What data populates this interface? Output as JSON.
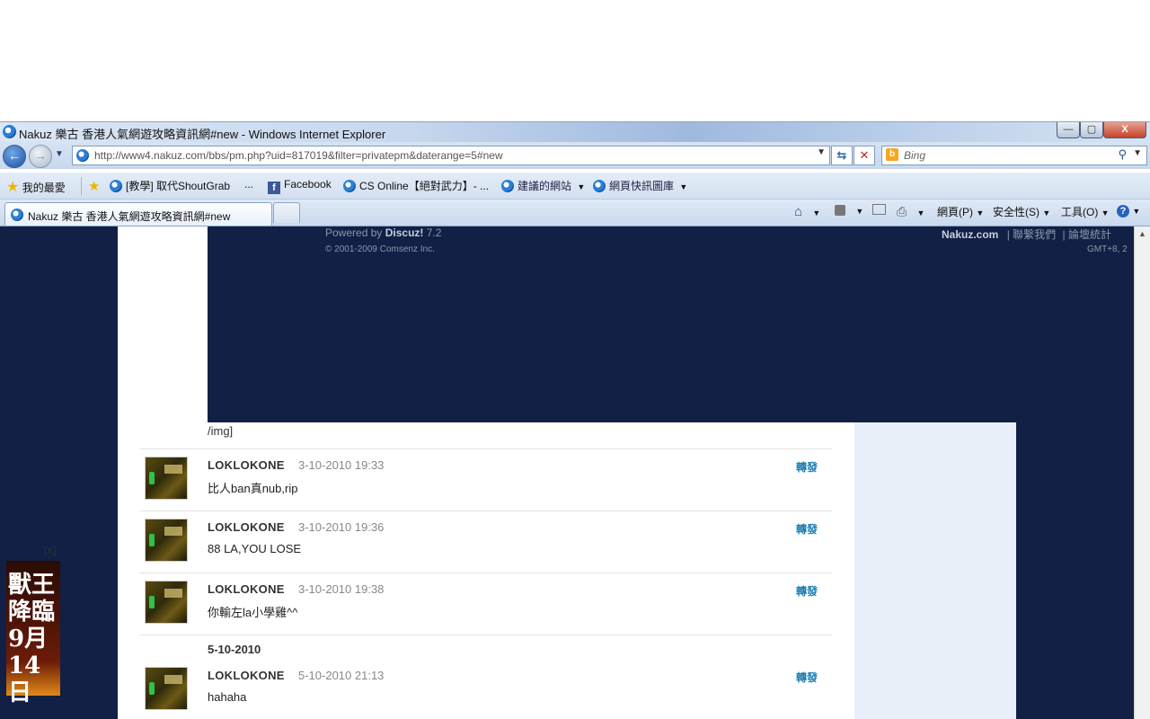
{
  "window": {
    "title": "Nakuz 樂古 香港人氣網遊攻略資訊網#new - Windows Internet Explorer",
    "buttons": {
      "minimize": "—",
      "maximize": "▢",
      "close": "X"
    }
  },
  "address_bar": {
    "url": "http://www4.nakuz.com/bbs/pm.php?uid=817019&filter=privatepm&daterange=5#new",
    "search_placeholder": "Bing"
  },
  "favorites_bar": {
    "favorites_label": "我的最愛",
    "items": [
      {
        "label": "[教學] 取代ShoutGrab",
        "icon": "ie-page-icon"
      },
      {
        "label": "...",
        "icon": ""
      },
      {
        "label": "Facebook",
        "icon": "facebook-icon"
      },
      {
        "label": "CS Online【絕對武力】- ...",
        "icon": "ie-page-icon"
      },
      {
        "label": "建議的網站",
        "icon": "ie-page-icon"
      },
      {
        "label": "網頁快訊圖庫",
        "icon": "ie-page-icon"
      }
    ]
  },
  "tabs": {
    "active_label": "Nakuz 樂古 香港人氣網遊攻略資訊網#new"
  },
  "command_bar": {
    "page_label": "網頁(P)",
    "safety_label": "安全性(S)",
    "tools_label": "工具(O)"
  },
  "footer": {
    "powered_prefix": "Powered by",
    "powered_brand": "Discuz!",
    "powered_version": "7.2",
    "copyright": "© 2001-2009 Comsenz Inc.",
    "site_name": "Nakuz.com",
    "contact": "聯繫我們",
    "stats": "論壇統計",
    "timezone": "GMT+8, 2"
  },
  "messages": {
    "prev_tail": "/img]",
    "items": [
      {
        "user": "LOKLOKONE",
        "time": "3-10-2010 19:33",
        "text": "比人ban真nub,rip",
        "forward": "轉發"
      },
      {
        "user": "LOKLOKONE",
        "time": "3-10-2010 19:36",
        "text": "88 LA,YOU LOSE",
        "forward": "轉發"
      },
      {
        "user": "LOKLOKONE",
        "time": "3-10-2010 19:38",
        "text": "你輸左la小學雞^^",
        "forward": "轉發"
      },
      {
        "user": "LOKLOKONE",
        "time": "5-10-2010 21:13",
        "text": "hahaha",
        "forward": "轉發"
      }
    ],
    "date_header": "5-10-2010"
  },
  "ad": {
    "close_label": "[X]",
    "text": "獸王降臨 9月14日"
  }
}
